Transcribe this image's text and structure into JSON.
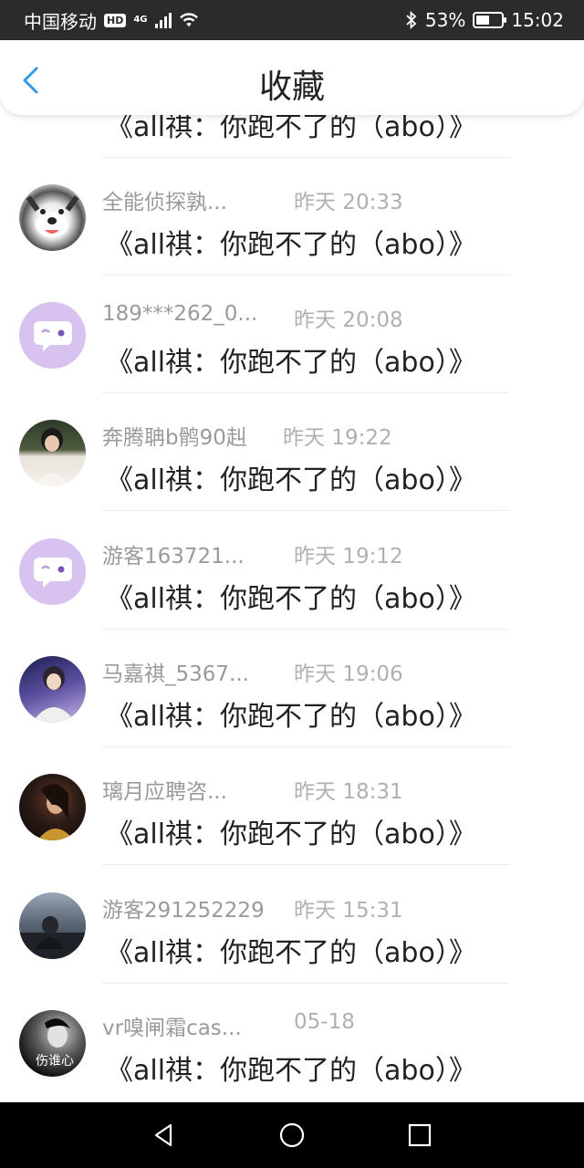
{
  "status": {
    "carrier": "中国移动",
    "hd": "HD",
    "network": "4G",
    "battery_pct": "53%",
    "battery_level": 0.53,
    "time": "15:02"
  },
  "header": {
    "title": "收藏"
  },
  "list": {
    "partial_item": {
      "content": "《all祺：你跑不了的（abo）》"
    },
    "items": [
      {
        "user": "全能侦探孰...",
        "time": "昨天 20:33",
        "content": "《all祺：你跑不了的（abo）》",
        "avatar": "husky-dog-avatar"
      },
      {
        "user": "189***262_0...",
        "time": "昨天 20:08",
        "content": "《all祺：你跑不了的（abo）》",
        "avatar": "default-chat-avatar"
      },
      {
        "user": "奔腾聃b鹘90赳",
        "time": "昨天 19:22",
        "content": "《all祺：你跑不了的（abo）》",
        "avatar": "girl-photo-avatar"
      },
      {
        "user": "游客163721...",
        "time": "昨天 19:12",
        "content": "《all祺：你跑不了的（abo）》",
        "avatar": "default-chat-avatar"
      },
      {
        "user": "马嘉祺_5367...",
        "time": "昨天 19:06",
        "content": "《all祺：你跑不了的（abo）》",
        "avatar": "idol-photo-avatar"
      },
      {
        "user": "璃月应聘咨...",
        "time": "昨天 18:31",
        "content": "《all祺：你跑不了的（abo）》",
        "avatar": "dark-portrait-avatar"
      },
      {
        "user": "游客291252229",
        "time": "昨天 15:31",
        "content": "《all祺：你跑不了的（abo）》",
        "avatar": "night-scene-avatar"
      },
      {
        "user": "vr嗅闸霜cas...",
        "time": "05-18",
        "content": "《all祺：你跑不了的（abo）》",
        "avatar": "bw-portrait-avatar",
        "avatar_caption": "伤谁心"
      }
    ]
  },
  "colors": {
    "accent": "#2f9be5",
    "avatar_default": "#d8c3f0",
    "muted_text": "#9a9a9a"
  }
}
